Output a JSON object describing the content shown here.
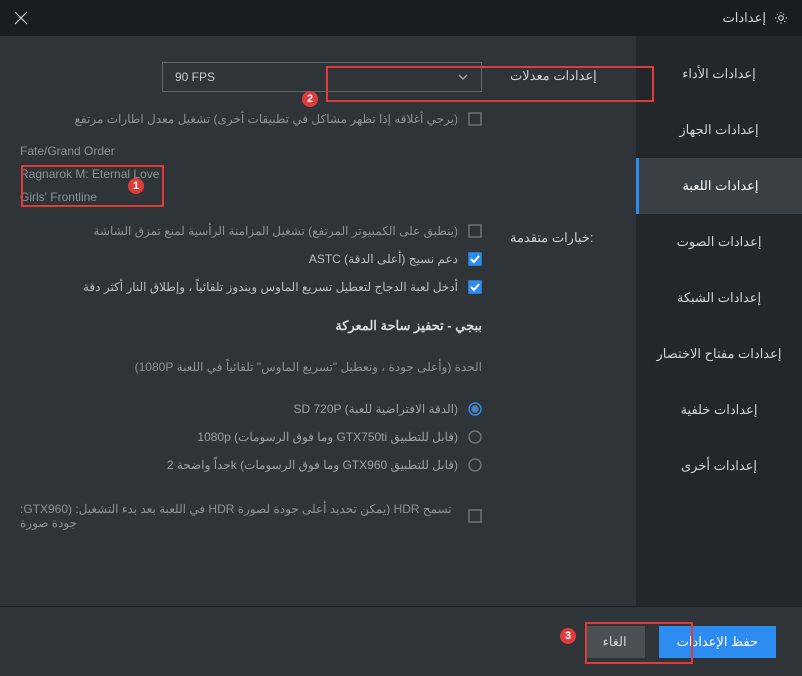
{
  "window": {
    "title": "إعدادات"
  },
  "sidebar": {
    "items": [
      {
        "label": "إعدادات الأداء"
      },
      {
        "label": "إعدادات الجهاز"
      },
      {
        "label": "إعدادات اللعبة"
      },
      {
        "label": "إعدادات الصوت"
      },
      {
        "label": "إعدادات الشبكة"
      },
      {
        "label": "إعدادات مفتاح الاختصار"
      },
      {
        "label": "إعدادات خلفية"
      },
      {
        "label": "إعدادات أخرى"
      }
    ],
    "activeIndex": 2
  },
  "sections": {
    "fps": {
      "label": "إعدادات معدلات",
      "selected": "90 FPS",
      "note": "(يرجي أغلاقه إذا تظهر مشاكل في تطبيقات أخرى)   تشغيل معدل اطارات مرتفع",
      "games": [
        "Fate/Grand Order",
        "Ragnarok M: Eternal Love",
        "Girls' Frontline"
      ]
    },
    "adv": {
      "label": ":خيارات متقدمة",
      "vsync": "(ينطبق على الكمبيوتر المرتفع)   تشغيل المزامنة الرأسية لمنع تمزق الشاشة",
      "astc": "ASTC دعم نسيج   (أعلى الدقة)",
      "mouse": "أدخل لعبة الدجاج لتعطيل تسريع الماوس ويندوز تلقائياً ، وإطلاق النار أكثر دقة"
    },
    "pubg": {
      "title": "ببجي - تحفيز ساحة المعركة",
      "subtitle": "الحدة   (وأعلى جودة ، وتعطيل \"تسريع الماوس\" تلقائياً في اللعبة 1080P)",
      "options": {
        "sd": "SD 720P   (الدقة الافتراضية للعبة)",
        "p1080": "1080p   (وما فوق الرسومات GTX750ti قابل للتطبيق)",
        "k2": "جداً واضحة 2k   (وما فوق الرسومات GTX960 قابل للتطبيق)"
      },
      "hdr": ":GTX960) :في اللعبة بعد بدء التشغيل HDR يمكن تحديد أعلى جودة لصورة)   HDR تسمح جودة صورة"
    }
  },
  "footer": {
    "save": "حفظ الإعدادات",
    "cancel": "الغاء"
  },
  "annotations": {
    "n1": "1",
    "n2": "2",
    "n3": "3"
  }
}
